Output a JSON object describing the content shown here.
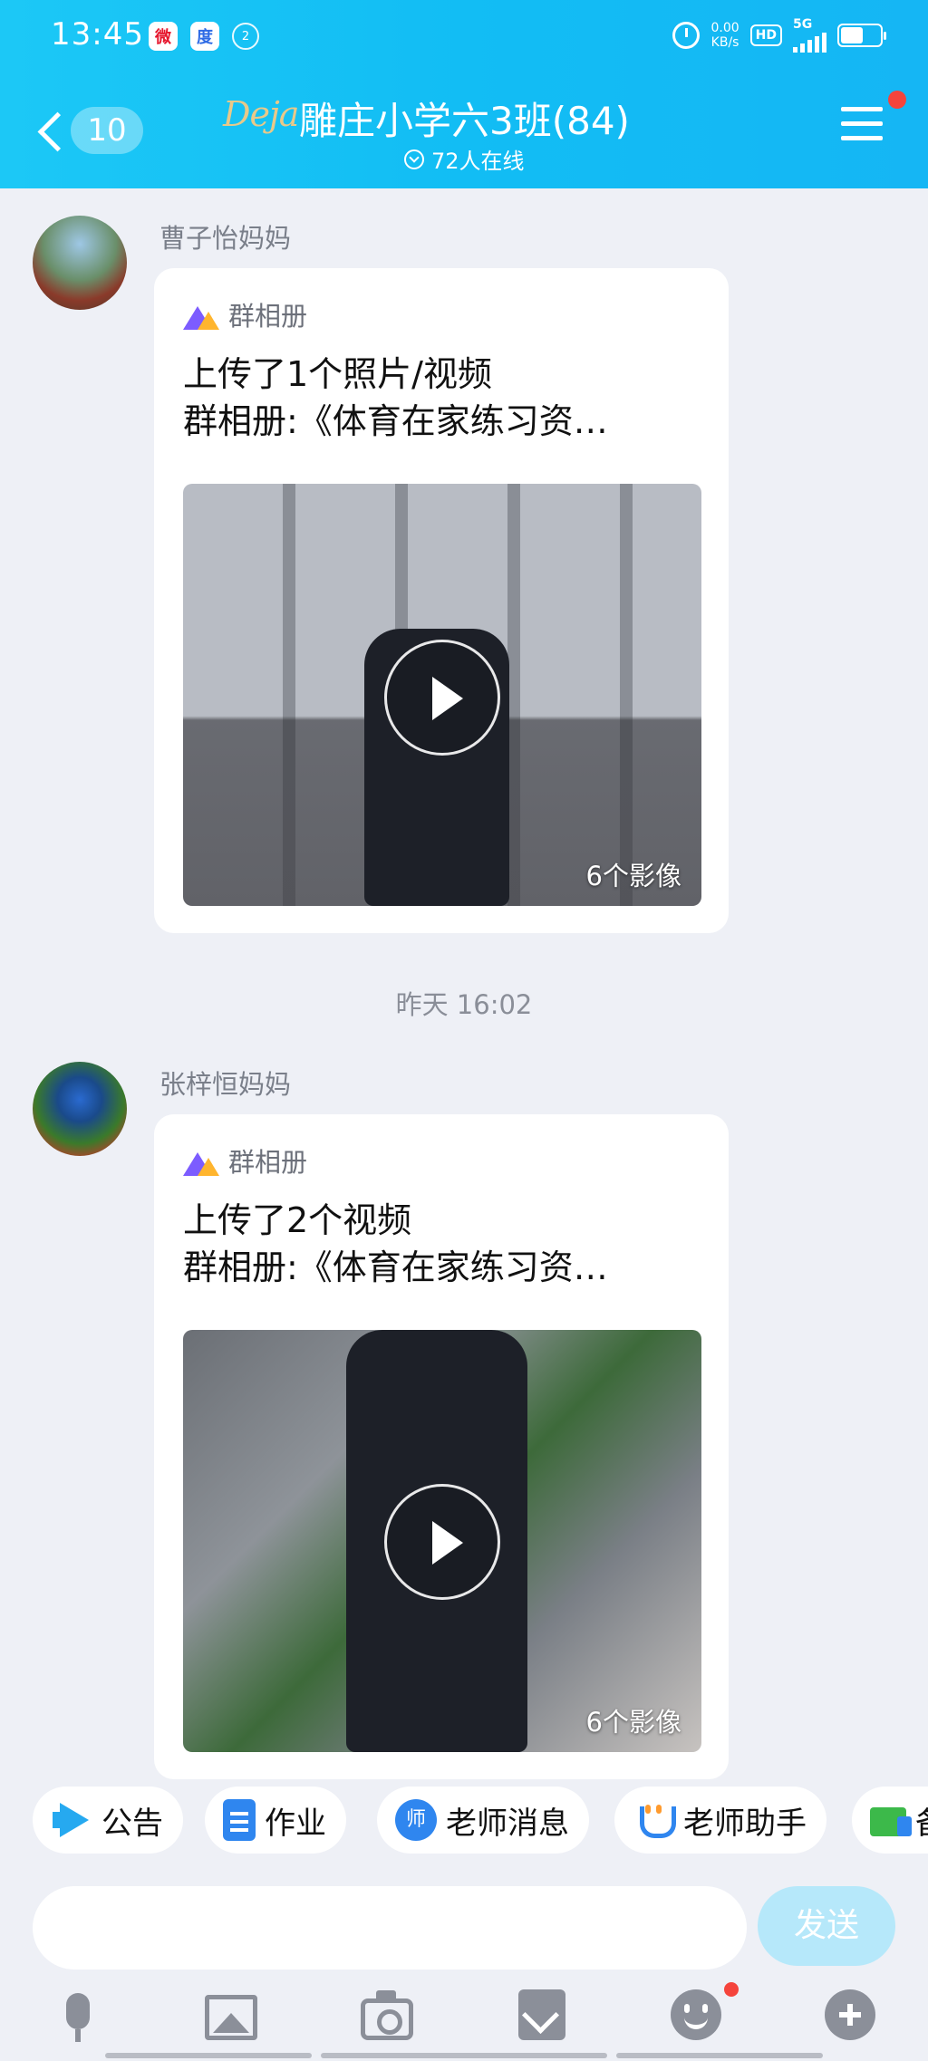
{
  "status_bar": {
    "time": "13:45",
    "left_icons": [
      "weibo-icon",
      "baidu-icon",
      "hotspot-icon"
    ],
    "hotspot_text": "2",
    "speed_value": "0.00",
    "speed_unit": "KB/s",
    "hd": "HD",
    "network": "5G",
    "battery_level": 0.56
  },
  "header": {
    "unread_count": "10",
    "logo_text": "Deja",
    "group_name": "雕庄小学六3班(84)",
    "online_text": "72人在线",
    "has_menu_badge": true
  },
  "messages": [
    {
      "sender": "曹子怡妈妈",
      "card_tag": "群相册",
      "line1": "上传了1个照片/视频",
      "line2": "群相册:《体育在家练习资…",
      "media_count": "6个影像"
    },
    {
      "sender": "张梓恒妈妈",
      "card_tag": "群相册",
      "line1": "上传了2个视频",
      "line2": "群相册:《体育在家练习资…",
      "media_count": "6个影像"
    }
  ],
  "timestamp": "昨天  16:02",
  "shortcuts": [
    {
      "label": "公告",
      "icon": "megaphone-icon"
    },
    {
      "label": "作业",
      "icon": "document-icon"
    },
    {
      "label": "老师消息",
      "icon": "teacher-icon",
      "glyph": "师"
    },
    {
      "label": "老师助手",
      "icon": "assistant-icon"
    },
    {
      "label": "备",
      "icon": "screen-icon"
    }
  ],
  "composer": {
    "placeholder": "",
    "send_label": "发送"
  },
  "toolbar": [
    "microphone-icon",
    "image-icon",
    "camera-icon",
    "red-packet-icon",
    "emoji-icon",
    "plus-icon"
  ],
  "colors": {
    "header": "#15bff5",
    "send_disabled": "#b6e8fa",
    "badge": "#f5443c"
  }
}
